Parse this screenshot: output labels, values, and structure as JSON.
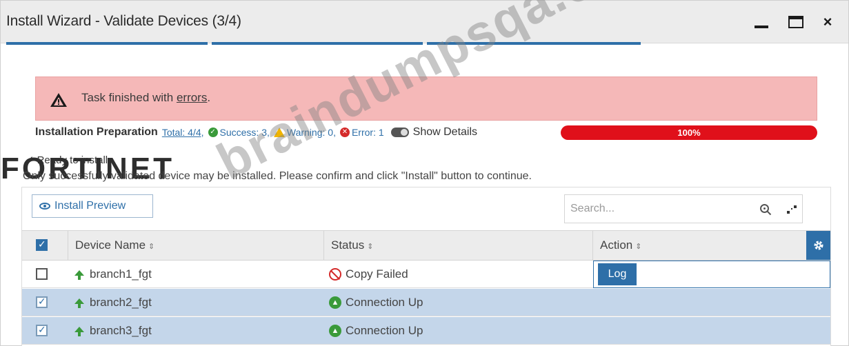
{
  "window": {
    "title": "Install Wizard - Validate Devices (3/4)",
    "minimize_icon": "minimize-icon",
    "maximize_icon": "maximize-icon",
    "close_glyph": "×"
  },
  "alert": {
    "text_prefix": "Task finished with ",
    "link_text": "errors",
    "text_suffix": ".",
    "color": "#f5b8b8"
  },
  "prep": {
    "label": "Installation Preparation",
    "total": "Total: 4/4,",
    "success": "Success: 3,",
    "warning": "Warning: 0,",
    "error": "Error: 1",
    "show_details": "Show Details",
    "progress_value": 100,
    "progress_label": "100%",
    "progress_color": "#e0101a"
  },
  "ready": {
    "text": "Ready to install"
  },
  "note": "Only successfully validated device may be installed. Please confirm and click \"Install\" button to continue.",
  "brand_logo_text": "FORTINET",
  "watermark": "braindumpsqa.com",
  "table": {
    "install_preview_label": "Install Preview",
    "search_placeholder": "Search...",
    "columns": {
      "name": "Device Name",
      "status": "Status",
      "action": "Action"
    },
    "sort_glyph": "⇕",
    "rows": [
      {
        "name": "branch1_fgt",
        "status": "Copy Failed",
        "checked": false,
        "action": "Log"
      },
      {
        "name": "branch2_fgt",
        "status": "Connection Up",
        "checked": true
      },
      {
        "name": "branch3_fgt",
        "status": "Connection Up",
        "checked": true
      }
    ]
  }
}
